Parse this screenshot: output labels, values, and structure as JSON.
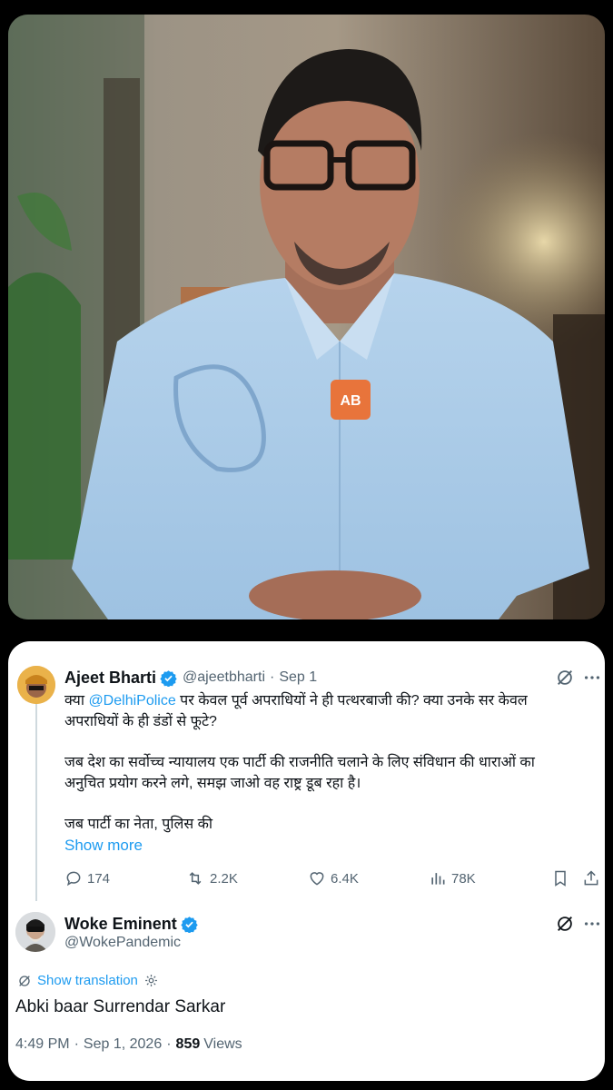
{
  "video": {
    "mic_logo_text": "AB"
  },
  "parent_tweet": {
    "author_name": "Ajeet Bharti",
    "handle": "@ajeetbharti",
    "separator": "·",
    "date": "Sep 1",
    "text_line1_prefix": "क्या ",
    "mention": "@DelhiPolice",
    "text_line1_suffix": " पर केवल पूर्व अपराधियों ने ही पत्थरबाजी की? क्या उनके सर केवल",
    "text_line2": "अपराधियों के ही डंडों से फूटे?",
    "paragraph2_line1": "जब देश का सर्वोच्च न्यायालय एक पार्टी की राजनीति चलाने के लिए संविधान की धाराओं का",
    "paragraph2_line2": "अनुचित प्रयोग करने लगे, समझ जाओ वह राष्ट्र डूब रहा है।",
    "paragraph3_line1": "जब पार्टी का नेता, पुलिस की",
    "show_more": "Show more",
    "replies": "174",
    "reposts": "2.2K",
    "likes": "6.4K",
    "views": "78K"
  },
  "reply_tweet": {
    "author_name": "Woke Eminent",
    "handle": "@WokePandemic",
    "show_translation": "Show translation",
    "text": "Abki baar Surrendar Sarkar",
    "time": "4:49 PM",
    "separator": "·",
    "date": "Sep 1, 2026",
    "separator2": "·",
    "views_count": "859",
    "views_label": "Views"
  },
  "colors": {
    "accent": "#1d9bf0",
    "muted": "#536471",
    "shirt": "#a9cbe6",
    "background": "#000000"
  }
}
